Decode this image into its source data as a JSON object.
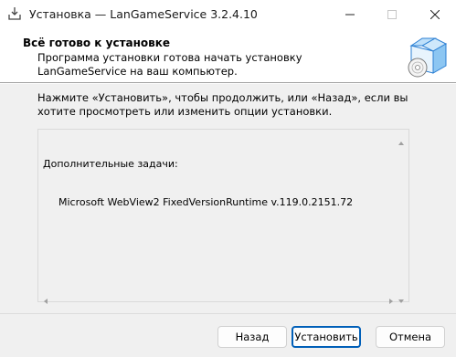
{
  "window": {
    "title": "Установка — LanGameService 3.2.4.10",
    "icon": "installer-icon"
  },
  "header": {
    "title": "Всё готово к установке",
    "subtitle": "Программа установки готова начать установку LanGameService на ваш компьютер.",
    "image": "setup-box-disc-icon"
  },
  "body": {
    "intro": "Нажмите «Установить», чтобы продолжить, или «Назад», если вы хотите просмотреть или изменить опции установки.",
    "memo": {
      "heading": "Дополнительные задачи:",
      "items": [
        "Microsoft WebView2 FixedVersionRuntime v.119.0.2151.72"
      ]
    }
  },
  "buttons": {
    "back": "Назад",
    "install": "Установить",
    "cancel": "Отмена"
  },
  "colors": {
    "accent": "#005fb8",
    "titlebar_bg": "#ffffff",
    "window_bg": "#f0f0f0"
  }
}
